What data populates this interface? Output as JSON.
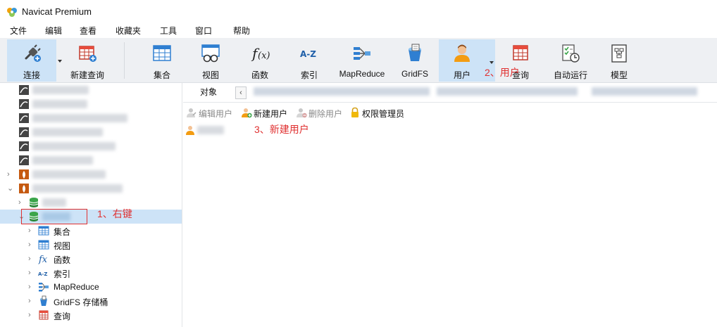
{
  "app": {
    "title": "Navicat Premium"
  },
  "menu": [
    "文件",
    "编辑",
    "查看",
    "收藏夹",
    "工具",
    "窗口",
    "帮助"
  ],
  "toolbar": {
    "connect": "连接",
    "new_query": "新建查询",
    "collection": "集合",
    "view": "视图",
    "function": "函数",
    "index": "索引",
    "mapreduce": "MapReduce",
    "gridfs": "GridFS",
    "user": "用户",
    "query": "查询",
    "automation": "自动运行",
    "model": "模型"
  },
  "tab": {
    "object": "对象"
  },
  "actions": {
    "edit_user": "编辑用户",
    "new_user": "新建用户",
    "delete_user": "删除用户",
    "privilege_manager": "权限管理员"
  },
  "tree": {
    "collection": "集合",
    "view": "视图",
    "function": "函数",
    "index": "索引",
    "mapreduce": "MapReduce",
    "gridfs": "GridFS 存储桶",
    "query": "查询"
  },
  "annotations": {
    "step1": "1、右键",
    "step2": "2、用户",
    "step3": "3、新建用户"
  },
  "colors": {
    "accent": "#cde3f7",
    "annotation": "#e03131",
    "db_green": "#3aa54a",
    "mongo_orange": "#c55a11"
  }
}
